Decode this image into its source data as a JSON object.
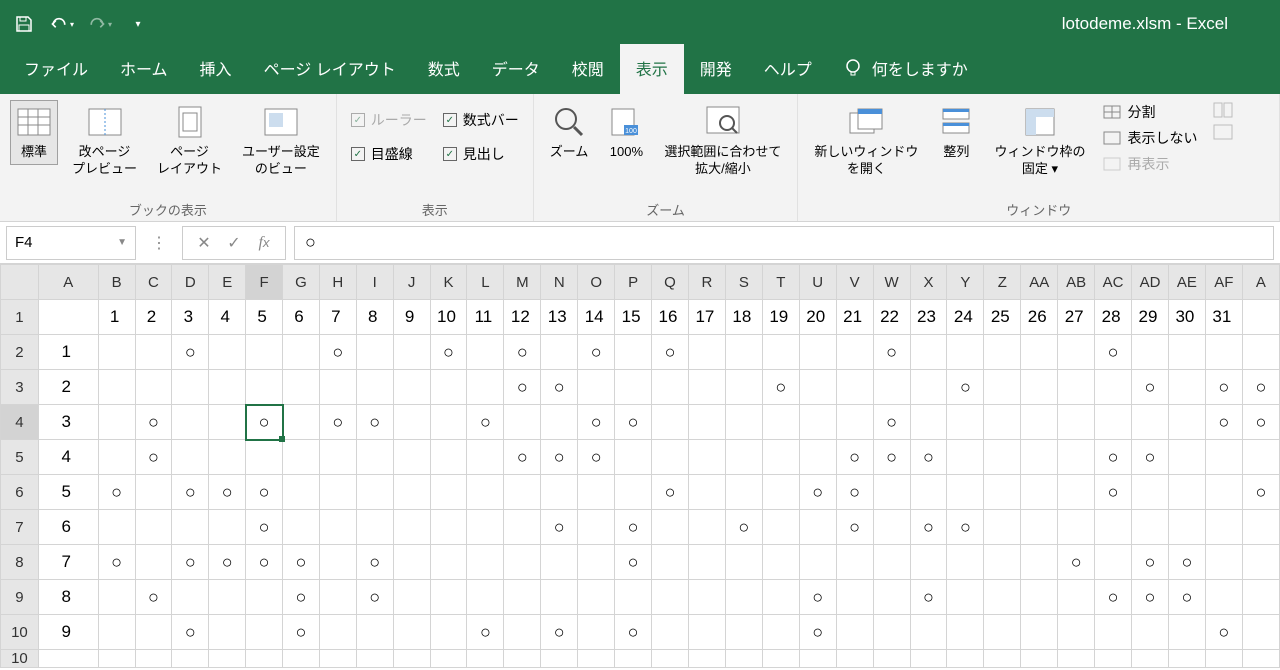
{
  "title": "lotodeme.xlsm  -  Excel",
  "qat": {
    "save": "save",
    "undo": "undo",
    "redo": "redo"
  },
  "tabs": {
    "file": "ファイル",
    "home": "ホーム",
    "insert": "挿入",
    "layout": "ページ レイアウト",
    "formulas": "数式",
    "data": "データ",
    "review": "校閲",
    "view": "表示",
    "dev": "開発",
    "help": "ヘルプ",
    "tell_me": "何をしますか"
  },
  "ribbon": {
    "views": {
      "normal": "標準",
      "page_break": "改ページ\nプレビュー",
      "page_layout": "ページ\nレイアウト",
      "custom": "ユーザー設定\nのビュー",
      "group": "ブックの表示"
    },
    "show": {
      "ruler": "ルーラー",
      "formula_bar": "数式バー",
      "gridlines": "目盛線",
      "headings": "見出し",
      "group": "表示"
    },
    "zoom": {
      "zoom": "ズーム",
      "p100": "100%",
      "selection": "選択範囲に合わせて\n拡大/縮小",
      "group": "ズーム"
    },
    "window": {
      "new_win": "新しいウィンドウ\nを開く",
      "arrange": "整列",
      "freeze": "ウィンドウ枠の\n固定 ▾",
      "split": "分割",
      "hide": "表示しない",
      "unhide": "再表示",
      "group": "ウィンドウ"
    }
  },
  "namebox": "F4",
  "formula_value": "○",
  "columns": [
    "A",
    "B",
    "C",
    "D",
    "E",
    "F",
    "G",
    "H",
    "I",
    "J",
    "K",
    "L",
    "M",
    "N",
    "O",
    "P",
    "Q",
    "R",
    "S",
    "T",
    "U",
    "V",
    "W",
    "X",
    "Y",
    "Z",
    "AA",
    "AB",
    "AC",
    "AD",
    "AE",
    "AF",
    "A"
  ],
  "header_row": [
    "",
    "1",
    "2",
    "3",
    "4",
    "5",
    "6",
    "7",
    "8",
    "9",
    "10",
    "11",
    "12",
    "13",
    "14",
    "15",
    "16",
    "17",
    "18",
    "19",
    "20",
    "21",
    "22",
    "23",
    "24",
    "25",
    "26",
    "27",
    "28",
    "29",
    "30",
    "31",
    ""
  ],
  "rows": [
    {
      "n": "1",
      "a": "1",
      "marks": [
        3,
        7,
        10,
        12,
        14,
        16,
        22,
        28
      ]
    },
    {
      "n": "2",
      "a": "2",
      "marks": [
        12,
        13,
        19,
        24,
        29,
        31,
        32
      ]
    },
    {
      "n": "3",
      "a": "3",
      "marks": [
        2,
        5,
        7,
        8,
        11,
        14,
        15,
        22,
        31,
        32
      ]
    },
    {
      "n": "4",
      "a": "4",
      "marks": [
        2,
        12,
        13,
        14,
        21,
        22,
        23,
        28,
        29
      ]
    },
    {
      "n": "5",
      "a": "5",
      "marks": [
        1,
        3,
        4,
        5,
        16,
        20,
        21,
        28,
        32
      ]
    },
    {
      "n": "6",
      "a": "6",
      "marks": [
        5,
        13,
        15,
        18,
        21,
        23,
        24
      ]
    },
    {
      "n": "7",
      "a": "7",
      "marks": [
        1,
        3,
        4,
        5,
        6,
        8,
        15,
        27,
        29,
        30
      ]
    },
    {
      "n": "8",
      "a": "8",
      "marks": [
        2,
        6,
        8,
        20,
        23,
        28,
        29,
        30
      ]
    },
    {
      "n": "9",
      "a": "9",
      "marks": [
        3,
        6,
        11,
        13,
        15,
        20,
        31
      ]
    }
  ],
  "active": {
    "row_index": 2,
    "col_index": 5
  }
}
